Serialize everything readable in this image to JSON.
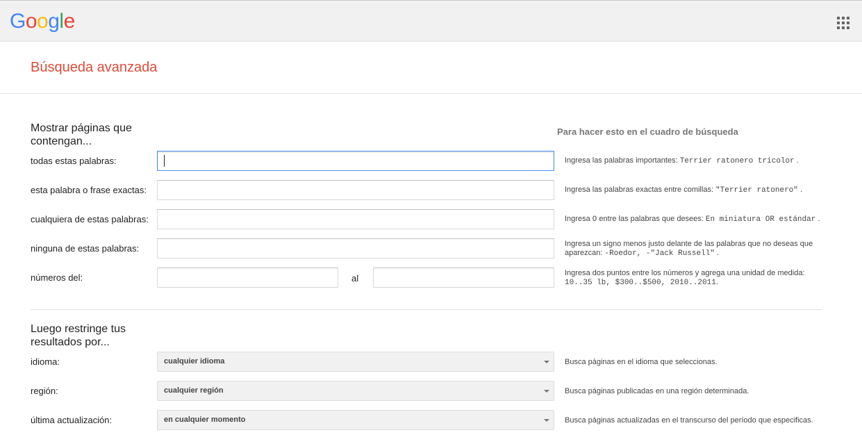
{
  "header": {
    "logo_letters": [
      "G",
      "o",
      "o",
      "g",
      "l",
      "e"
    ],
    "logo_colors": [
      "#4285f4",
      "#ea4335",
      "#fbbc05",
      "#4285f4",
      "#34a853",
      "#ea4335"
    ],
    "apps_icon": "apps-grid-icon"
  },
  "page": {
    "title": "Búsqueda avanzada"
  },
  "section1": {
    "heading": "Mostrar páginas que contengan...",
    "column_heading": "Para hacer esto en el cuadro de búsqueda",
    "rows": [
      {
        "label": "todas estas palabras:",
        "value": "",
        "hint_text": "Ingresa las palabras importantes: ",
        "hint_code": "Terrier ratonero tricolor",
        "hint_end": "."
      },
      {
        "label": "esta palabra o frase exactas:",
        "value": "",
        "hint_text": "Ingresa las palabras exactas entre comillas: ",
        "hint_code": "\"Terrier ratonero\"",
        "hint_end": "."
      },
      {
        "label": "cualquiera de estas palabras:",
        "value": "",
        "hint_text": "Ingresa ",
        "hint_code_mid": "O",
        "hint_text2": " entre las palabras que desees: ",
        "hint_code": "En miniatura OR estándar",
        "hint_end": "."
      },
      {
        "label": "ninguna de estas palabras:",
        "value": "",
        "hint_text": "Ingresa un signo menos justo delante de las palabras que no deseas que aparezcan: ",
        "hint_code": "-Roedor, -\"Jack Russell\"",
        "hint_end": "."
      },
      {
        "label": "números del:",
        "to_label": "al",
        "hint_text": "Ingresa dos puntos entre los números y agrega una unidad de medida: ",
        "hint_code": "10..35 lb, $300..$500, 2010..2011",
        "hint_end": "."
      }
    ]
  },
  "section2": {
    "heading": "Luego restringe tus resultados por...",
    "rows": [
      {
        "label": "idioma:",
        "selected": "cualquier idioma",
        "hint": "Busca páginas en el idioma que seleccionas."
      },
      {
        "label": "región:",
        "selected": "cualquier región",
        "hint": "Busca páginas publicadas en una región determinada."
      },
      {
        "label": "última actualización:",
        "selected": "en cualquier momento",
        "hint": "Busca páginas actualizadas en el transcurso del período que especificas."
      }
    ]
  }
}
